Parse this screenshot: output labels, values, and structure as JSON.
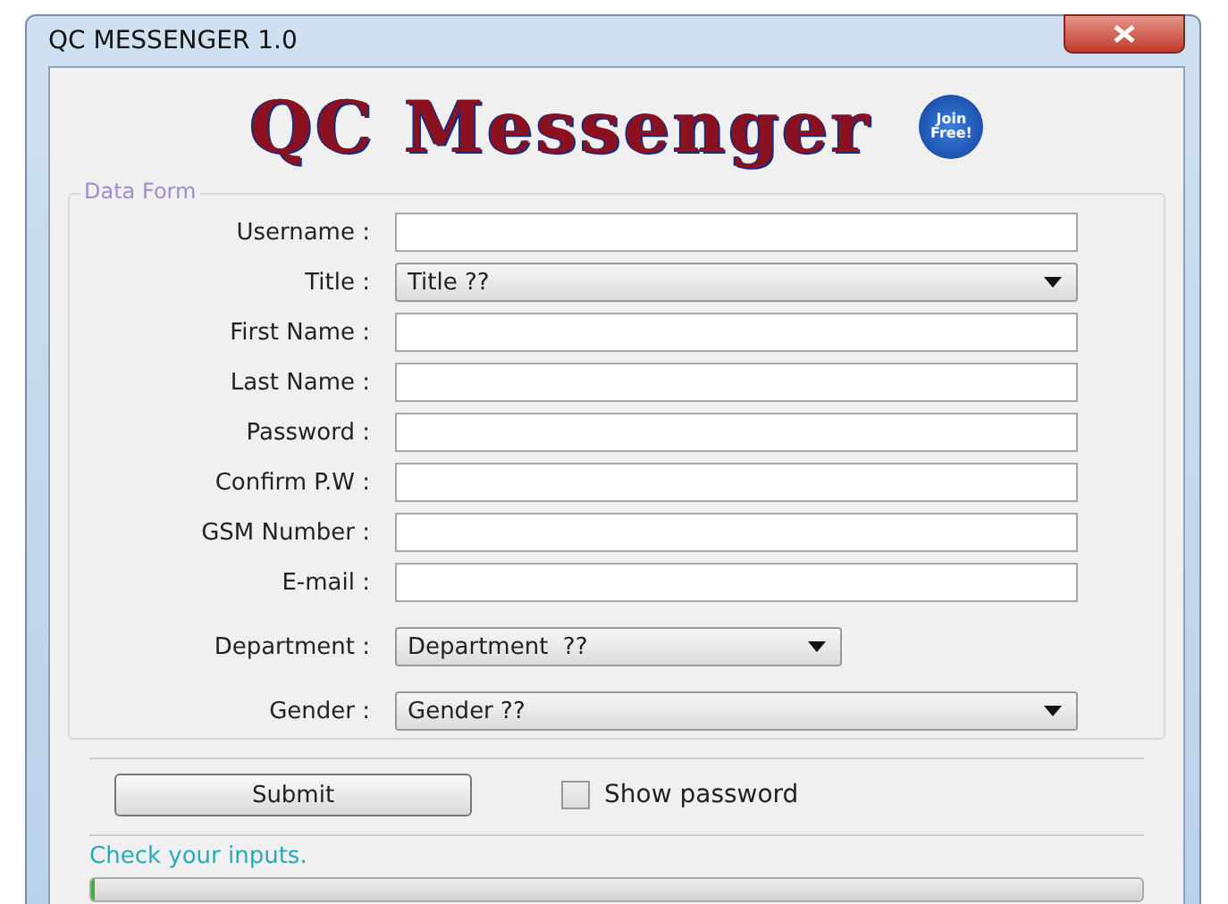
{
  "window": {
    "title": "QC MESSENGER 1.0"
  },
  "logo": {
    "text": "QC Messenger",
    "badge": "Join Free!"
  },
  "form": {
    "legend": "Data Form",
    "fields": [
      {
        "kind": "input",
        "label": "Username :",
        "wide": true
      },
      {
        "kind": "combo",
        "label": "Title :",
        "value": "Title ??",
        "wide": true
      },
      {
        "kind": "input",
        "label": "First Name :",
        "wide": true
      },
      {
        "kind": "input",
        "label": "Last Name :",
        "wide": true
      },
      {
        "kind": "input",
        "label": "Password :",
        "wide": true
      },
      {
        "kind": "input",
        "label": "Confirm P.W :",
        "wide": true
      },
      {
        "kind": "input",
        "label": "GSM Number :",
        "wide": true
      },
      {
        "kind": "input",
        "label": "E-mail :",
        "wide": true
      },
      {
        "kind": "combo",
        "label": "Department :",
        "value": "Department  ??",
        "wide": false
      },
      {
        "kind": "combo",
        "label": "Gender :",
        "value": "Gender ??",
        "wide": true
      }
    ]
  },
  "submit": "Submit",
  "show_password": {
    "label": "Show password",
    "checked": false
  },
  "status": "Check your inputs.",
  "progress": {
    "level": 0
  }
}
